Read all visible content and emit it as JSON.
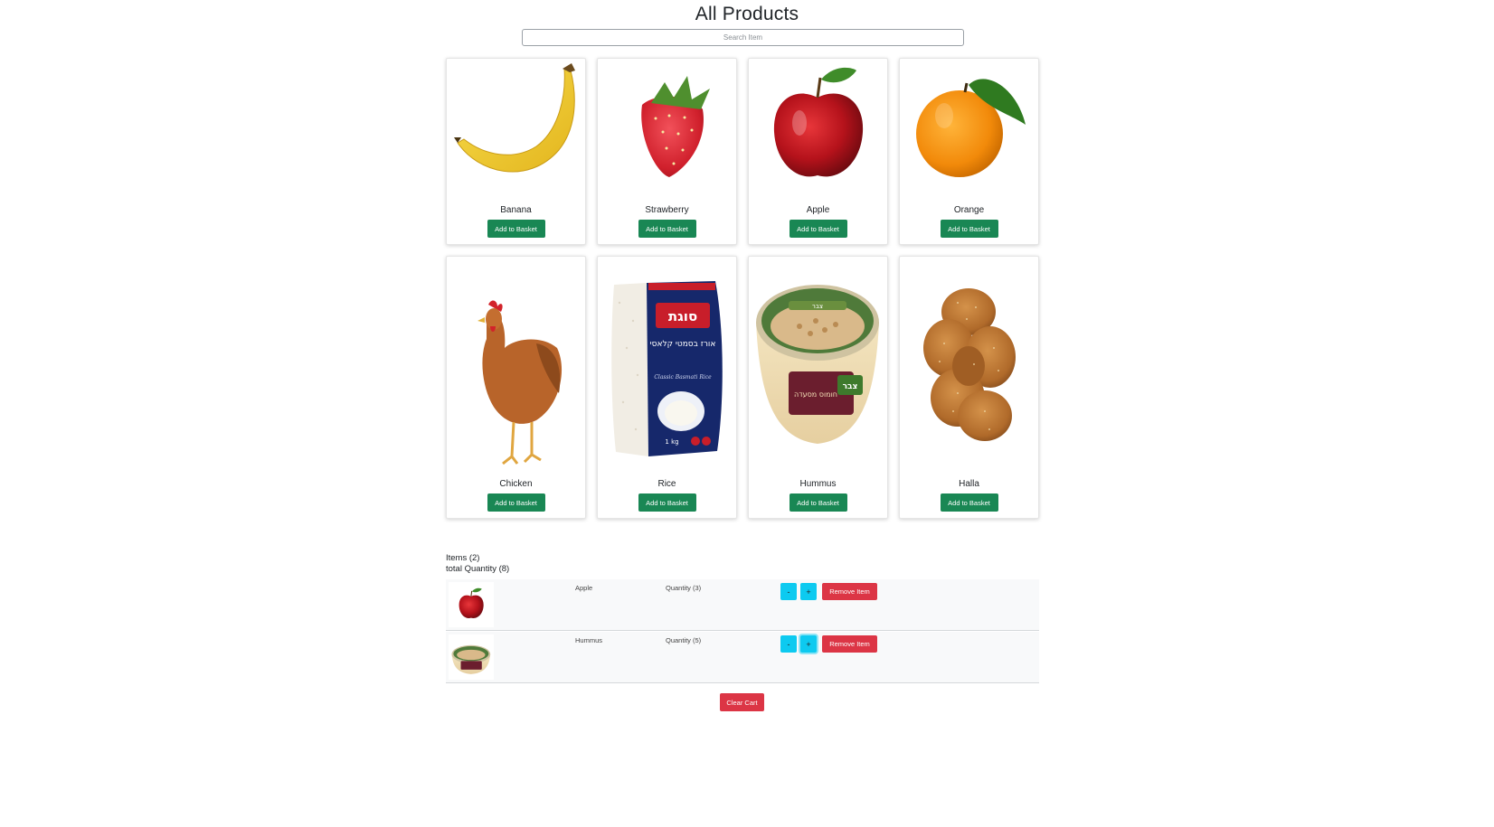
{
  "page": {
    "title": "All Products"
  },
  "search": {
    "placeholder": "Search Item",
    "value": ""
  },
  "products": [
    {
      "name": "Banana",
      "button": "Add to Basket",
      "icon": "banana-image"
    },
    {
      "name": "Strawberry",
      "button": "Add to Basket",
      "icon": "strawberry-image"
    },
    {
      "name": "Apple",
      "button": "Add to Basket",
      "icon": "apple-image"
    },
    {
      "name": "Orange",
      "button": "Add to Basket",
      "icon": "orange-image"
    },
    {
      "name": "Chicken",
      "button": "Add to Basket",
      "icon": "chicken-image"
    },
    {
      "name": "Rice",
      "button": "Add to Basket",
      "icon": "rice-package-image",
      "package_brand": "סוגת",
      "package_text": "אורז בסמטי קלאסי",
      "package_subtitle": "Classic Basmati Rice",
      "package_weight": "1 kg"
    },
    {
      "name": "Hummus",
      "button": "Add to Basket",
      "icon": "hummus-tub-image",
      "package_brand": "צבר",
      "package_text": "חומוס מסעדה"
    },
    {
      "name": "Halla",
      "button": "Add to Basket",
      "icon": "halla-bread-image"
    }
  ],
  "cart": {
    "items_label": "Items (2)",
    "total_label": "total Quantity (8)",
    "minus_label": "-",
    "plus_label": "+",
    "remove_label": "Remove Item",
    "items": [
      {
        "name": "Apple",
        "quantity": "Quantity (3)",
        "icon": "apple-image"
      },
      {
        "name": "Hummus",
        "quantity": "Quantity (5)",
        "icon": "hummus-tub-image"
      }
    ],
    "clear_label": "Clear Cart"
  },
  "colors": {
    "primary_button": "#198754",
    "info_button": "#0dcaf0",
    "danger_button": "#dc3545"
  }
}
